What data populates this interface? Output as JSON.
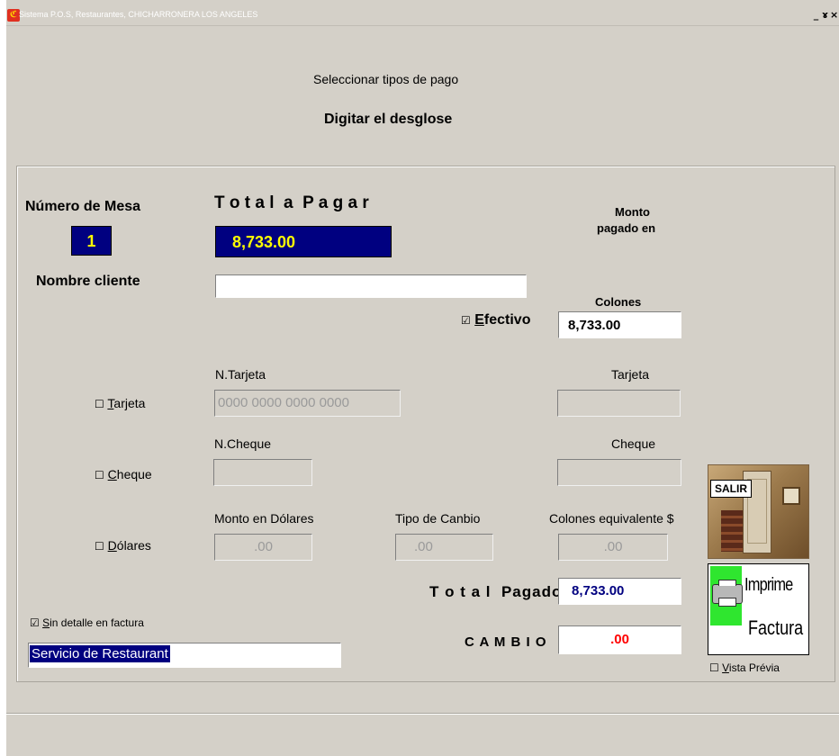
{
  "window": {
    "title": "Sistema P.O.S, Restaurantes,  CHICHARRONERA LOS ANGELES",
    "icon_text": "ℭ",
    "controls": [
      "_",
      "ɤ",
      "×"
    ]
  },
  "header": {
    "line1": "Seleccionar tipos de pago",
    "line2": "Digitar el desglose"
  },
  "mesa": {
    "label": "Número de  Mesa",
    "value": "1"
  },
  "total": {
    "label": "T o t a l  a  P a g a r",
    "value": "8,733.00"
  },
  "monto": {
    "label_line1": "Monto",
    "label_line2": "pagado en"
  },
  "cliente": {
    "label": "Nombre cliente",
    "value": ""
  },
  "efectivo": {
    "check": "☑",
    "label_underlined": "E",
    "label_rest": "fectivo",
    "col_label": "Colones",
    "value": "8,733.00"
  },
  "tarjeta": {
    "check": "☐",
    "label_underlined": "T",
    "label_rest": "arjeta",
    "num_label": "N.Tarjeta",
    "num_value": "0000 0000 0000 0000",
    "amount_label": "Tarjeta",
    "amount_value": ""
  },
  "cheque": {
    "check": "☐",
    "label_underlined": "C",
    "label_rest": "heque",
    "num_label": "N.Cheque",
    "num_value": "",
    "amount_label": "Cheque",
    "amount_value": ""
  },
  "dolares": {
    "check": "☐",
    "label_underlined": "D",
    "label_rest": "ólares",
    "monto_label": "Monto en Dólares",
    "monto_value": ".00",
    "tipo_label": "Tipo de Canbio",
    "tipo_value": ".00",
    "colones_label": "Colones equivalente $",
    "colones_value": ".00"
  },
  "total_pagado": {
    "label": "T o t a l  Pagado",
    "value": "8,733.00"
  },
  "cambio": {
    "label": "C A M B I O",
    "value": ".00"
  },
  "sin_detalle": {
    "check": "☑",
    "label_underlined": "S",
    "label_rest": "in detalle en factura",
    "value": "Servicio de Restaurant"
  },
  "buttons": {
    "salir": "SALIR",
    "imprime_line1": "Imprime",
    "imprime_line2": "Factura"
  },
  "vista_previa": {
    "check": "☐",
    "label_underlined": "V",
    "label_rest": "ista Prévia"
  },
  "colors": {
    "title_text": "#ffffff",
    "window_bg": "#d4d0c8",
    "navy_field": "#000080",
    "yellow_text": "#ffff00",
    "total_pagado_text": "#000080",
    "cambio_text": "#ff0000",
    "printer_green": "#2fe62f"
  }
}
